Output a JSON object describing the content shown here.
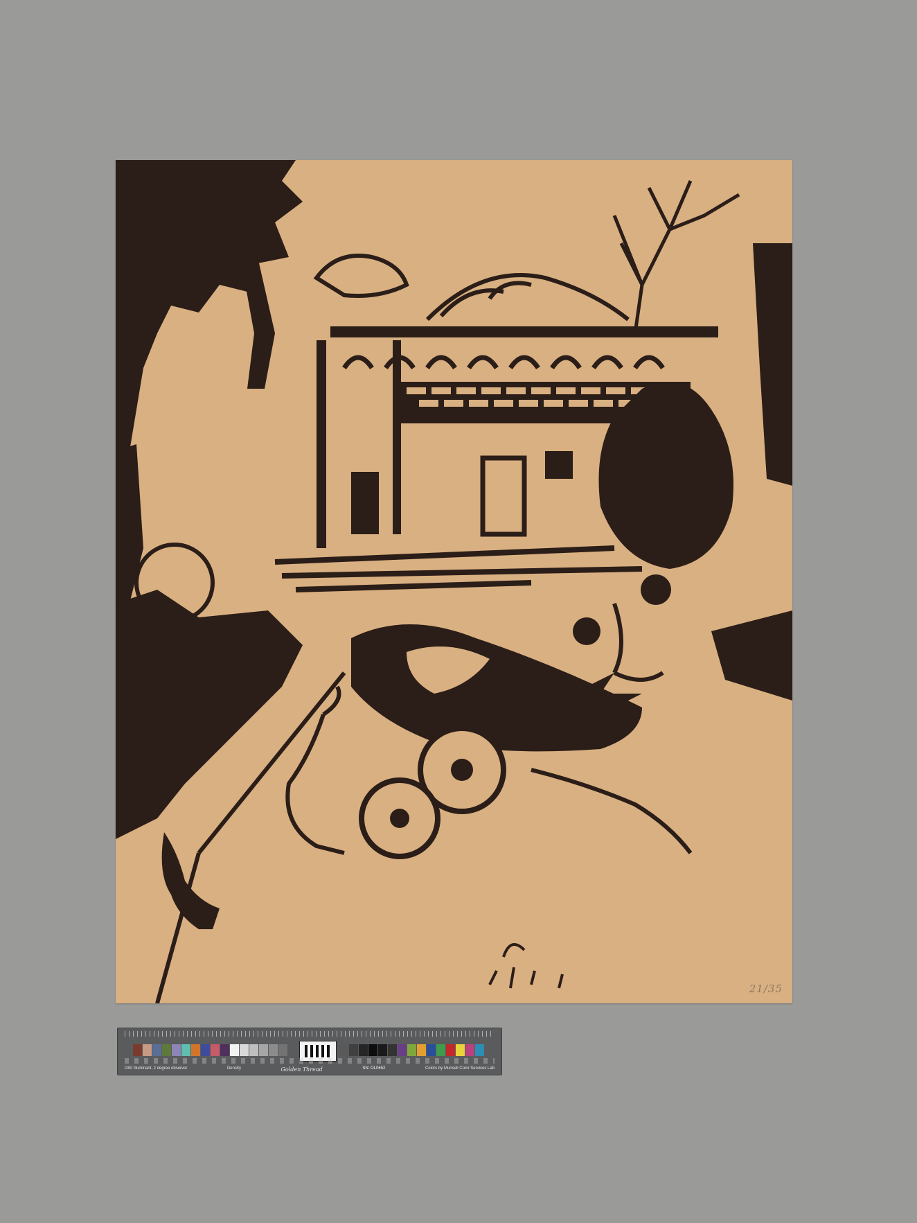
{
  "artwork": {
    "edition": "21/35"
  },
  "color_target": {
    "left_caption": "D50 Illuminant, 2 degree observer",
    "density_caption": "Density",
    "brand": "Golden Thread",
    "serial": "SN: OL0652",
    "right_caption": "Colors by Munsell Color Services Lab",
    "patches_left": [
      "#7b3a2e",
      "#c79a84",
      "#5a6f98",
      "#5e7a3a",
      "#8d84b7",
      "#5fbeb0",
      "#d2752a",
      "#3d4d9c",
      "#c65a68",
      "#4f2f5e",
      "#f2f2f2",
      "#d9d9d9",
      "#bfbfbf",
      "#a6a6a6",
      "#8c8c8c",
      "#737373"
    ],
    "patches_right": [
      "#595959",
      "#404040",
      "#262626",
      "#0d0d0d",
      "#1a1a1a",
      "#333333",
      "#6a3e86",
      "#7ea83d",
      "#e3a030",
      "#2a4f9a",
      "#3f9c4c",
      "#c2282b",
      "#e8d33a",
      "#b8427e",
      "#2e8db3"
    ]
  }
}
